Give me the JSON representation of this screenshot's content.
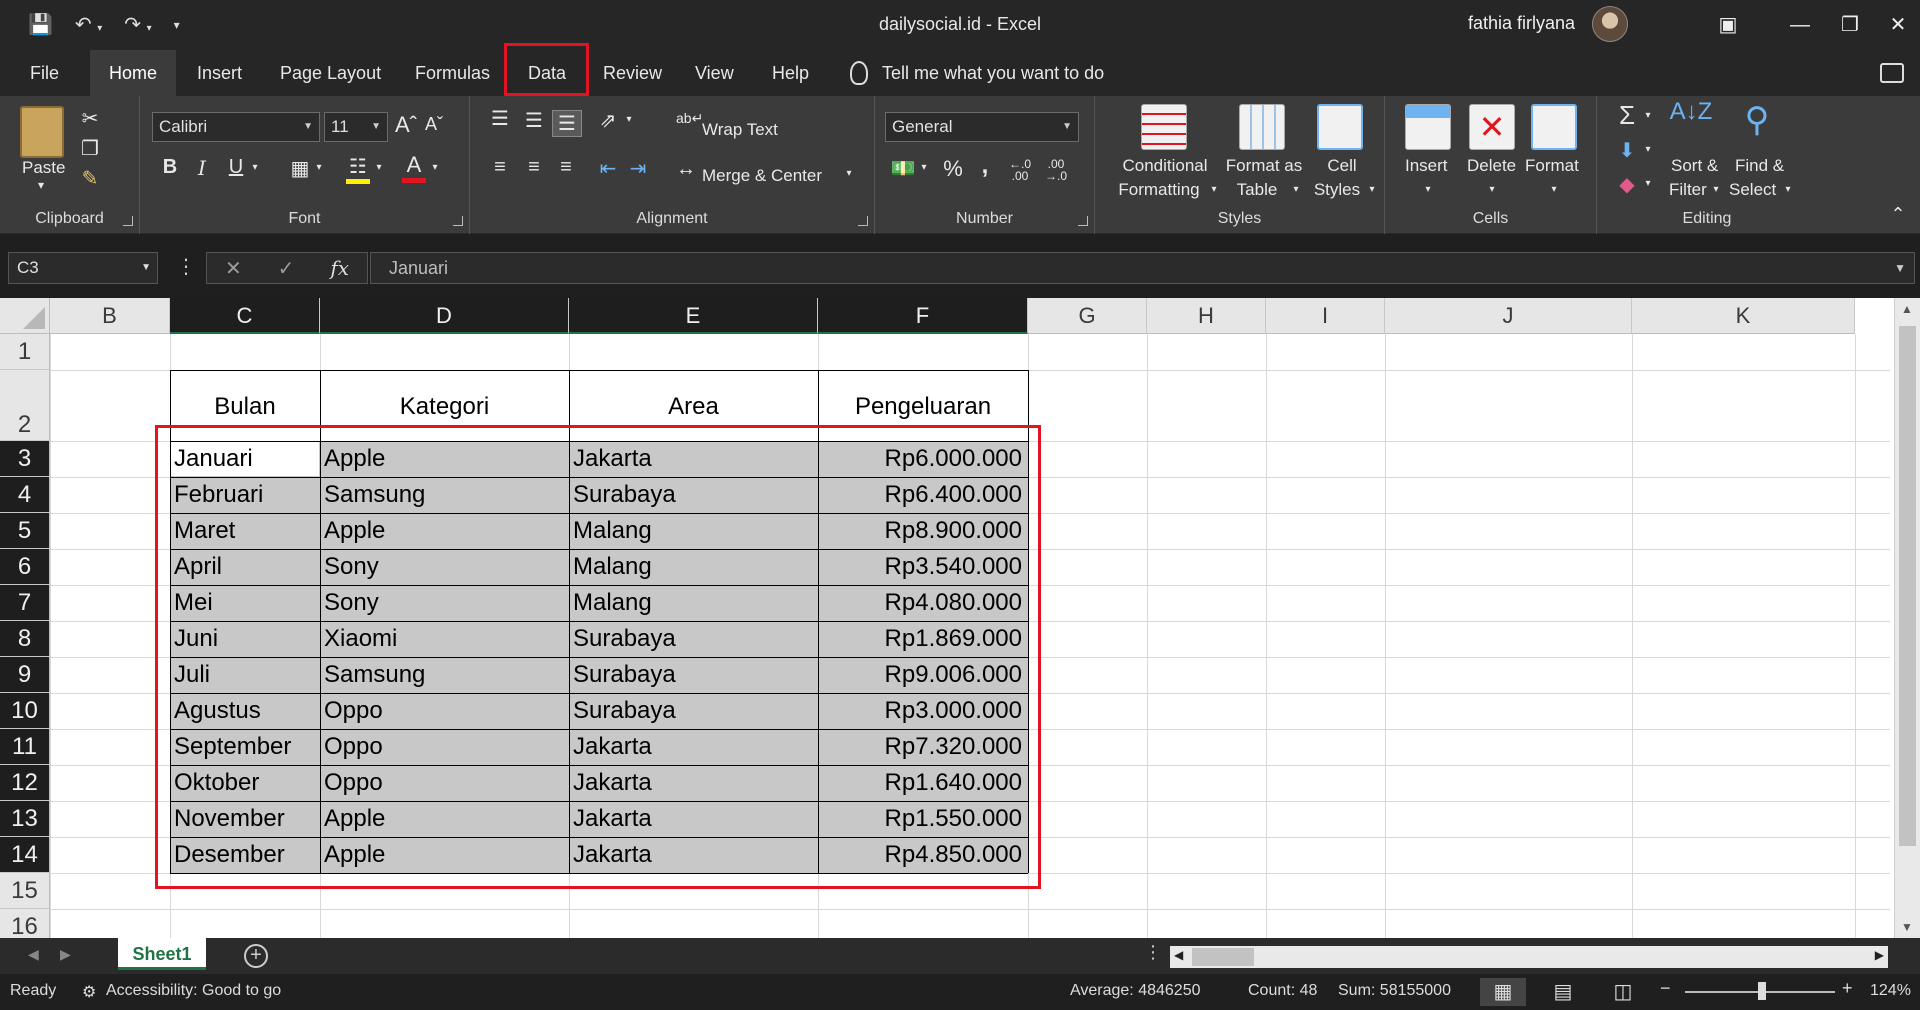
{
  "window": {
    "title": "dailysocial.id  -  Excel",
    "user_name": "fathia firlyana"
  },
  "tabs": [
    {
      "label": "File"
    },
    {
      "label": "Home"
    },
    {
      "label": "Insert"
    },
    {
      "label": "Page Layout"
    },
    {
      "label": "Formulas"
    },
    {
      "label": "Data"
    },
    {
      "label": "Review"
    },
    {
      "label": "View"
    },
    {
      "label": "Help"
    }
  ],
  "tell_me": "Tell me what you want to do",
  "ribbon": {
    "clipboard": {
      "paste": "Paste",
      "label": "Clipboard"
    },
    "font": {
      "family": "Calibri",
      "size": "11",
      "label": "Font",
      "bold": "B",
      "italic": "I",
      "underline": "U"
    },
    "alignment": {
      "wrap": "Wrap Text",
      "merge": "Merge & Center",
      "label": "Alignment"
    },
    "number": {
      "format": "General",
      "label": "Number",
      "percent": "%",
      "comma": ","
    },
    "styles": {
      "conditional_1": "Conditional",
      "conditional_2": "Formatting",
      "format_as_1": "Format as",
      "format_as_2": "Table",
      "cell_styles_1": "Cell",
      "cell_styles_2": "Styles",
      "label": "Styles"
    },
    "cells": {
      "insert": "Insert",
      "delete": "Delete",
      "format": "Format",
      "label": "Cells"
    },
    "editing": {
      "sort_1": "Sort &",
      "sort_2": "Filter",
      "find_1": "Find &",
      "find_2": "Select",
      "label": "Editing"
    }
  },
  "formula_bar": {
    "name_box": "C3",
    "formula": "Januari"
  },
  "columns": [
    "B",
    "C",
    "D",
    "E",
    "F",
    "G",
    "H",
    "I",
    "J",
    "K"
  ],
  "rows": [
    "1",
    "2",
    "3",
    "4",
    "5",
    "6",
    "7",
    "8",
    "9",
    "10",
    "11",
    "12",
    "13",
    "14",
    "15",
    "16"
  ],
  "table": {
    "headers": [
      "Bulan",
      "Kategori",
      "Area",
      "Pengeluaran"
    ],
    "rows": [
      [
        "Januari",
        "Apple",
        "Jakarta",
        "Rp6.000.000"
      ],
      [
        "Februari",
        "Samsung",
        "Surabaya",
        "Rp6.400.000"
      ],
      [
        "Maret",
        "Apple",
        "Malang",
        "Rp8.900.000"
      ],
      [
        "April",
        "Sony",
        "Malang",
        "Rp3.540.000"
      ],
      [
        "Mei",
        "Sony",
        "Malang",
        "Rp4.080.000"
      ],
      [
        "Juni",
        "Xiaomi",
        "Surabaya",
        "Rp1.869.000"
      ],
      [
        "Juli",
        "Samsung",
        "Surabaya",
        "Rp9.006.000"
      ],
      [
        "Agustus",
        "Oppo",
        "Surabaya",
        "Rp3.000.000"
      ],
      [
        "September",
        "Oppo",
        "Jakarta",
        "Rp7.320.000"
      ],
      [
        "Oktober",
        "Oppo",
        "Jakarta",
        "Rp1.640.000"
      ],
      [
        "November",
        "Apple",
        "Jakarta",
        "Rp1.550.000"
      ],
      [
        "Desember",
        "Apple",
        "Jakarta",
        "Rp4.850.000"
      ]
    ]
  },
  "sheet_tab": "Sheet1",
  "status": {
    "ready": "Ready",
    "accessibility": "Accessibility: Good to go",
    "average": "Average: 4846250",
    "count": "Count: 48",
    "sum": "Sum: 58155000",
    "zoom": "124%"
  },
  "colors": {
    "accent": "#217346",
    "highlight": "#e3131f"
  }
}
